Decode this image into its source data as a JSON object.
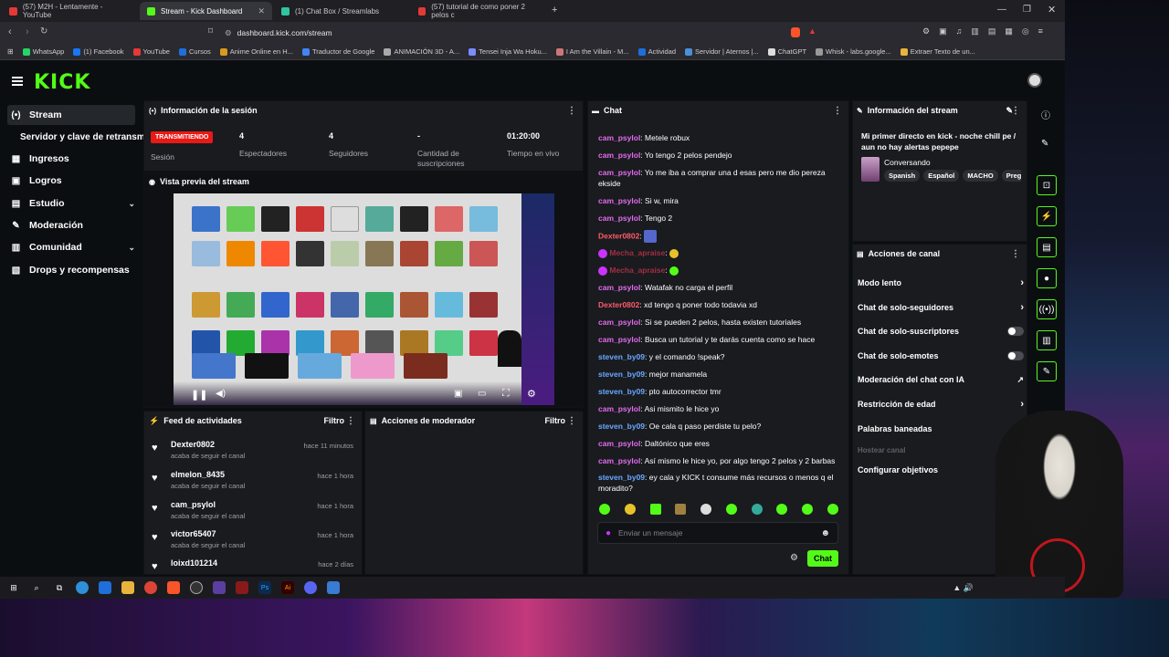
{
  "browser": {
    "tabs": [
      {
        "label": "(57) M2H - Lentamente - YouTube",
        "color": "#e53935"
      },
      {
        "label": "Stream - Kick Dashboard",
        "color": "#53fc18"
      },
      {
        "label": "(1) Chat Box / Streamlabs",
        "color": "#31c3a2"
      },
      {
        "label": "(57) tutorial de como poner 2 pelos c",
        "color": "#e53935"
      }
    ],
    "url": "dashboard.kick.com/stream",
    "bookmarks": [
      "WhatsApp",
      "(1) Facebook",
      "YouTube",
      "Cursos",
      "Anime Online en H...",
      "Traductor de Google",
      "ANIMACIÓN 3D - A...",
      "Tensei Inja Wa Hoku...",
      "I Am the Villain - M...",
      "Actividad",
      "Servidor | Aternos |...",
      "ChatGPT",
      "Whisk - labs.google...",
      "Extraer Texto de un..."
    ]
  },
  "app": {
    "logo": "KICK",
    "sidebar": [
      {
        "label": "Stream",
        "icon": "(•)",
        "active": true
      },
      {
        "label": "Servidor y clave de retransm",
        "icon": "",
        "active": false
      },
      {
        "label": "Ingresos",
        "icon": "▦",
        "active": false
      },
      {
        "label": "Logros",
        "icon": "▣",
        "active": false
      },
      {
        "label": "Estudio",
        "icon": "▤",
        "active": false,
        "chevron": "⌄"
      },
      {
        "label": "Moderación",
        "icon": "✎",
        "active": false
      },
      {
        "label": "Comunidad",
        "icon": "▥",
        "active": false,
        "chevron": "⌄"
      },
      {
        "label": "Drops y recompensas",
        "icon": "▧",
        "active": false
      }
    ]
  },
  "session": {
    "title": "Información de la sesión",
    "badge": "TRANSMITIENDO",
    "badge_label": "Sesión",
    "stats": [
      {
        "value": "4",
        "label": "Espectadores"
      },
      {
        "value": "4",
        "label": "Seguidores"
      },
      {
        "value": "-",
        "label": "Cantidad de suscripciones"
      },
      {
        "value": "01:20:00",
        "label": "Tiempo en vivo"
      }
    ]
  },
  "preview": {
    "title": "Vista previa del stream"
  },
  "feed": {
    "title": "Feed de actividades",
    "filter": "Filtro",
    "items": [
      {
        "name": "Dexter0802",
        "sub": "acaba de seguir el canal",
        "time": "hace 11 minutos"
      },
      {
        "name": "elmelon_8435",
        "sub": "acaba de seguir el canal",
        "time": "hace 1 hora"
      },
      {
        "name": "cam_psylol",
        "sub": "acaba de seguir el canal",
        "time": "hace 1 hora"
      },
      {
        "name": "victor65407",
        "sub": "acaba de seguir el canal",
        "time": "hace 1 hora"
      },
      {
        "name": "loixd101214",
        "sub": "",
        "time": "hace 2 días"
      }
    ]
  },
  "modactions": {
    "title": "Acciones de moderador",
    "filter": "Filtro"
  },
  "chat": {
    "title": "Chat",
    "messages": [
      {
        "user": "cam_psylol",
        "color": "#e36bf0",
        "text": "Metele robux"
      },
      {
        "user": "cam_psylol",
        "color": "#e36bf0",
        "text": "Yo tengo 2 pelos pendejo"
      },
      {
        "user": "cam_psylol",
        "color": "#e36bf0",
        "text": "Yo me iba a comprar una d esas pero me dio pereza ekside"
      },
      {
        "user": "cam_psylol",
        "color": "#e36bf0",
        "text": "Si w, mira"
      },
      {
        "user": "cam_psylol",
        "color": "#e36bf0",
        "text": "Tengo 2"
      },
      {
        "user": "Dexter0802",
        "color": "#ff5a6a",
        "text": ""
      },
      {
        "user": "Mecha_apraise",
        "color": "#ff3b5c",
        "text": ""
      },
      {
        "user": "Mecha_apraise",
        "color": "#ff3b5c",
        "text": ""
      },
      {
        "user": "cam_psylol",
        "color": "#e36bf0",
        "text": "Watafak no carga el perfil"
      },
      {
        "user": "Dexter0802",
        "color": "#ff5a6a",
        "text": "xd tengo q poner todo todavia xd"
      },
      {
        "user": "cam_psylol",
        "color": "#e36bf0",
        "text": "Si se pueden 2 pelos, hasta existen tutoriales"
      },
      {
        "user": "cam_psylol",
        "color": "#e36bf0",
        "text": "Busca un tutorial y te darás cuenta como se hace"
      },
      {
        "user": "steven_by09",
        "color": "#6aa8ff",
        "text": "y el comando !speak?"
      },
      {
        "user": "steven_by09",
        "color": "#6aa8ff",
        "text": "mejor manamela"
      },
      {
        "user": "steven_by09",
        "color": "#6aa8ff",
        "text": "pto autocorrector tmr"
      },
      {
        "user": "cam_psylol",
        "color": "#e36bf0",
        "text": "Asi mismito le hice yo"
      },
      {
        "user": "steven_by09",
        "color": "#6aa8ff",
        "text": "Oe cala q paso perdiste tu pelo?"
      },
      {
        "user": "cam_psylol",
        "color": "#e36bf0",
        "text": "Daltónico que eres"
      },
      {
        "user": "cam_psylol",
        "color": "#e36bf0",
        "text": "Así mismo le hice yo, por algo tengo 2 pelos y 2 barbas"
      },
      {
        "user": "steven_by09",
        "color": "#6aa8ff",
        "text": "ey cala y KICK t consume más recursos o menos q el moradito?"
      }
    ],
    "placeholder": "Enviar un mensaje",
    "send": "Chat"
  },
  "streaminfo": {
    "title": "Información del stream",
    "stream_title": "Mi primer directo en kick - noche chill pe / aun no hay alertas pepepe",
    "category": "Conversando",
    "tags": [
      "Spanish",
      "Español",
      "MACHO",
      "Preg"
    ]
  },
  "channel_actions": {
    "title": "Acciones de canal",
    "items": [
      {
        "label": "Modo lento",
        "control": "chevron"
      },
      {
        "label": "Chat de solo-seguidores",
        "control": "chevron"
      },
      {
        "label": "Chat de solo-suscriptores",
        "control": "toggle"
      },
      {
        "label": "Chat de solo-emotes",
        "control": "toggle"
      },
      {
        "label": "Moderación del chat con IA",
        "control": "external"
      },
      {
        "label": "Restricción de edad",
        "control": "chevron"
      },
      {
        "label": "Palabras baneadas",
        "control": "chevron"
      },
      {
        "label": "Hostear canal",
        "control": "disabled"
      },
      {
        "label": "Configurar objetivos",
        "control": "none"
      }
    ]
  },
  "colors": {
    "accent": "#53fc18",
    "live": "#e91916"
  }
}
